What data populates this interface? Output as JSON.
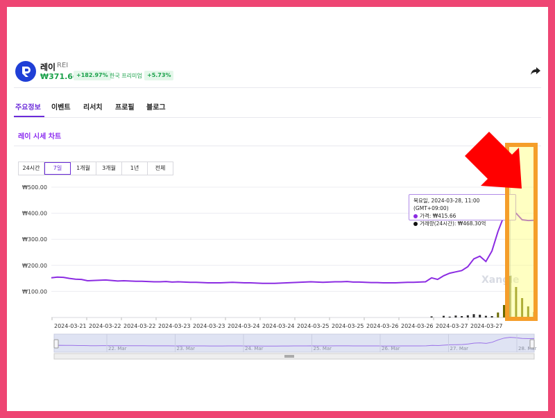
{
  "coin": {
    "name": "레이",
    "symbol": "REI",
    "price": "₩371.663",
    "change": "+182.97%",
    "premium_label": "한국 프리미엄",
    "premium_value": "+5.73%"
  },
  "tabs": [
    {
      "label": "주요정보",
      "active": true
    },
    {
      "label": "이벤트"
    },
    {
      "label": "리서치"
    },
    {
      "label": "프로필"
    },
    {
      "label": "블로그"
    }
  ],
  "chart_section_title": "레이 시세 차트",
  "ranges": [
    {
      "label": "24시간"
    },
    {
      "label": "7일",
      "active": true
    },
    {
      "label": "1개월"
    },
    {
      "label": "3개월"
    },
    {
      "label": "1년"
    },
    {
      "label": "전체"
    }
  ],
  "watermark": "Xangle",
  "tooltip": {
    "header": "목요일, 2024-03-28, 11:00 (GMT+09:00)",
    "price_line": "가격: ₩415.66",
    "volume_line": "거래량(24시간): ₩468.30억"
  },
  "navigator_labels": [
    "22. Mar",
    "23. Mar",
    "24. Mar",
    "25. Mar",
    "26. Mar",
    "27. Mar",
    "28. Mar"
  ],
  "colors": {
    "price_line": "#8b2be2",
    "volume_bar": "#2b2b2b",
    "highlight_volume_bar": "#6b6b00",
    "accent": "#6b2bd9",
    "arrow": "#ff0000",
    "highlight_border": "#f59e2a"
  },
  "chart_data": {
    "type": "line",
    "ylim": [
      0,
      500
    ],
    "yticks": [
      100,
      200,
      300,
      400,
      500
    ],
    "ytick_labels": [
      "₩100.00",
      "₩200.00",
      "₩300.00",
      "₩400.00",
      "₩500.00"
    ],
    "xtick_labels": [
      "2024-03-21",
      "2024-03-22",
      "2024-03-22",
      "2024-03-23",
      "2024-03-23",
      "2024-03-24",
      "2024-03-24",
      "2024-03-25",
      "2024-03-25",
      "2024-03-26",
      "2024-03-26",
      "2024-03-27",
      "2024-03-27"
    ],
    "series": [
      {
        "values": [
          152,
          155,
          154,
          150,
          147,
          146,
          141,
          142,
          143,
          144,
          142,
          140,
          141,
          140,
          139,
          139,
          138,
          137,
          137,
          138,
          136,
          137,
          136,
          135,
          135,
          134,
          133,
          133,
          133,
          134,
          135,
          134,
          133,
          133,
          132,
          131,
          131,
          131,
          132,
          133,
          134,
          135,
          136,
          137,
          136,
          135,
          136,
          137,
          137,
          138,
          136,
          136,
          135,
          134,
          134,
          133,
          133,
          133,
          134,
          135,
          135,
          136,
          137,
          152,
          146,
          160,
          170,
          175,
          180,
          195,
          225,
          235,
          215,
          255,
          330,
          390,
          415,
          400,
          375,
          372,
          373
        ]
      }
    ],
    "volume": [
      0,
      0,
      0,
      0,
      0,
      0,
      0,
      0,
      0,
      0,
      0,
      0,
      0,
      0,
      0,
      0,
      0,
      0,
      0,
      0,
      0,
      0,
      0,
      0,
      0,
      0,
      0,
      0,
      0,
      0,
      0,
      0,
      0,
      0,
      0,
      0,
      0,
      0,
      0,
      0,
      0,
      0,
      0,
      0,
      0,
      0,
      0,
      0,
      0,
      0,
      0,
      0,
      0,
      0,
      0,
      0,
      0,
      0,
      0,
      0,
      0,
      0,
      0,
      4,
      0,
      6,
      3,
      7,
      5,
      8,
      12,
      10,
      6,
      5,
      18,
      45,
      150,
      110,
      70,
      40,
      20
    ],
    "tooltip_index": 76
  }
}
